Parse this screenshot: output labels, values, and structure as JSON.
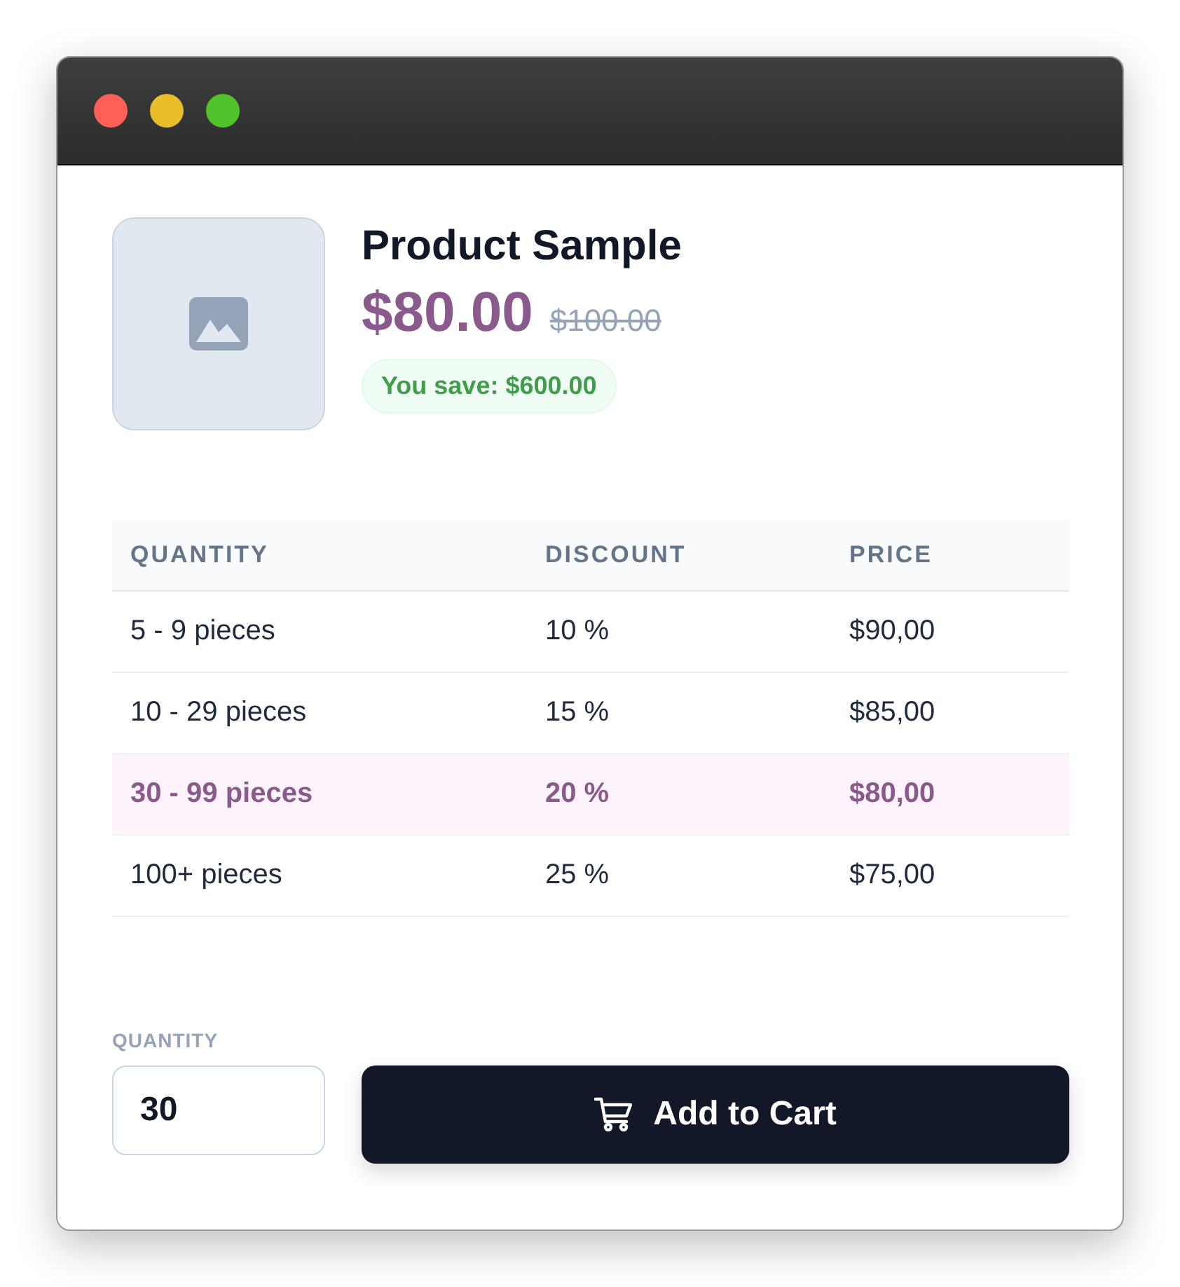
{
  "product": {
    "title": "Product Sample",
    "price": "$80.00",
    "old_price": "$100.00",
    "savings": "You save: $600.00"
  },
  "table": {
    "columns": [
      "QUANTITY",
      "DISCOUNT",
      "PRICE"
    ],
    "rows": [
      {
        "cells": [
          "5 - 9 pieces",
          "10 %",
          "$90,00"
        ],
        "selected": false
      },
      {
        "cells": [
          "10 - 29 pieces",
          "15 %",
          "$85,00"
        ],
        "selected": false
      },
      {
        "cells": [
          "30 - 99 pieces",
          "20 %",
          "$80,00"
        ],
        "selected": true
      },
      {
        "cells": [
          "100+ pieces",
          "25 %",
          "$75,00"
        ],
        "selected": false
      }
    ]
  },
  "quantity": {
    "label": "QUANTITY",
    "value": "30"
  },
  "buttons": [
    "Add to Cart"
  ]
}
